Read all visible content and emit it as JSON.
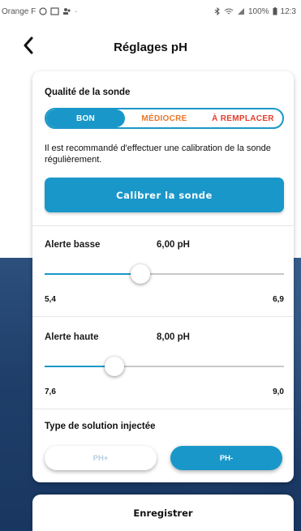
{
  "status_bar": {
    "carrier": "Orange F",
    "right_text": "100%",
    "time": "12:3"
  },
  "header": {
    "title": "Réglages pH"
  },
  "probe_quality": {
    "label": "Qualité de la sonde",
    "options": [
      "BON",
      "MÉDIOCRE",
      "À REMPLACER"
    ],
    "selected": "BON",
    "info": "Il est recommandé d'effectuer une calibration de la sonde régulièrement.",
    "calibrate_button": "Calibrer la sonde"
  },
  "alert_low": {
    "label": "Alerte basse",
    "value": "6,00 pH",
    "min": "5,4",
    "max": "6,9",
    "level": 0.4
  },
  "alert_high": {
    "label": "Alerte haute",
    "value": "8,00 pH",
    "min": "7,6",
    "max": "9,0",
    "level": 0.29
  },
  "solution_type": {
    "label": "Type de solution injectée",
    "options": [
      "PH+",
      "PH-"
    ],
    "selected": "PH-"
  },
  "save_button": "Enregistrer",
  "colors": {
    "accent": "#1a97c9",
    "medium": "#e8782a",
    "replace": "#e53d2c"
  }
}
